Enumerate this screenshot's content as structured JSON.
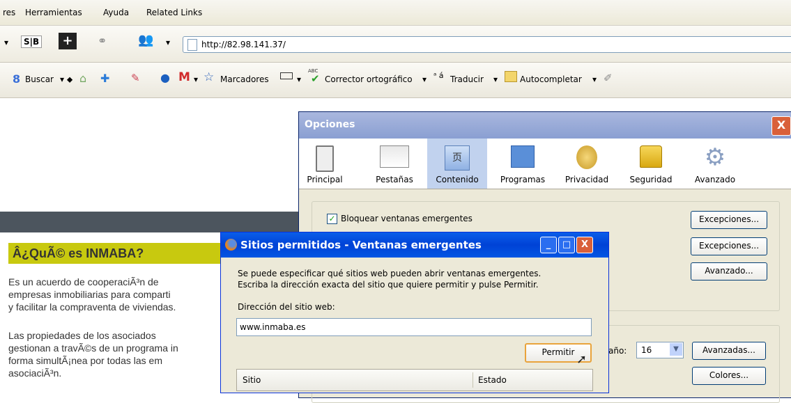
{
  "menubar": {
    "items": [
      "res",
      "Herramientas",
      "Ayuda",
      "Related Links"
    ]
  },
  "navbar": {
    "sb_label": "S|B",
    "plus_label": "+",
    "url": "http://82.98.141.37/"
  },
  "toolbar": {
    "buscar": "Buscar",
    "marcadores": "Marcadores",
    "corrector": "Corrector ortográfico",
    "traducir": "Traducir",
    "autocompletar": "Autocompletar",
    "abc": "ABC"
  },
  "page": {
    "heading": "Â¿QuÃ© es INMABA?",
    "para1": [
      "Es un acuerdo de cooperaciÃ³n de",
      "empresas inmobiliarias para comparti",
      "y facilitar la compraventa de viviendas."
    ],
    "para2": [
      "Las propiedades de los asociados",
      "gestionan a travÃ©s de un programa in",
      "forma simultÃ¡nea por todas las em",
      "asociaciÃ³n."
    ]
  },
  "opciones": {
    "title": "Opciones",
    "close": "X",
    "tabs": [
      "Principal",
      "Pestañas",
      "Contenido",
      "Programas",
      "Privacidad",
      "Seguridad",
      "Avanzado"
    ],
    "bloquear": "Bloquear ventanas emergentes",
    "btn_excepciones1": "Excepciones...",
    "btn_excepciones2": "Excepciones...",
    "btn_avanzado": "Avanzado...",
    "tamano_label": "año:",
    "tamano_value": "16",
    "btn_avanzadas": "Avanzadas...",
    "btn_colores": "Colores..."
  },
  "sitios": {
    "title": "Sitios permitidos - Ventanas emergentes",
    "desc1": "Se puede especificar qué sitios web pueden abrir ventanas emergentes.",
    "desc2": "Escriba la dirección exacta del sitio que quiere permitir y pulse Permitir.",
    "dir_label": "Dirección del sitio web:",
    "dir_value": "www.inmaba.es",
    "permitir": "Permitir",
    "col_sitio": "Sitio",
    "col_estado": "Estado",
    "min": "_",
    "max": "□",
    "close": "X"
  }
}
